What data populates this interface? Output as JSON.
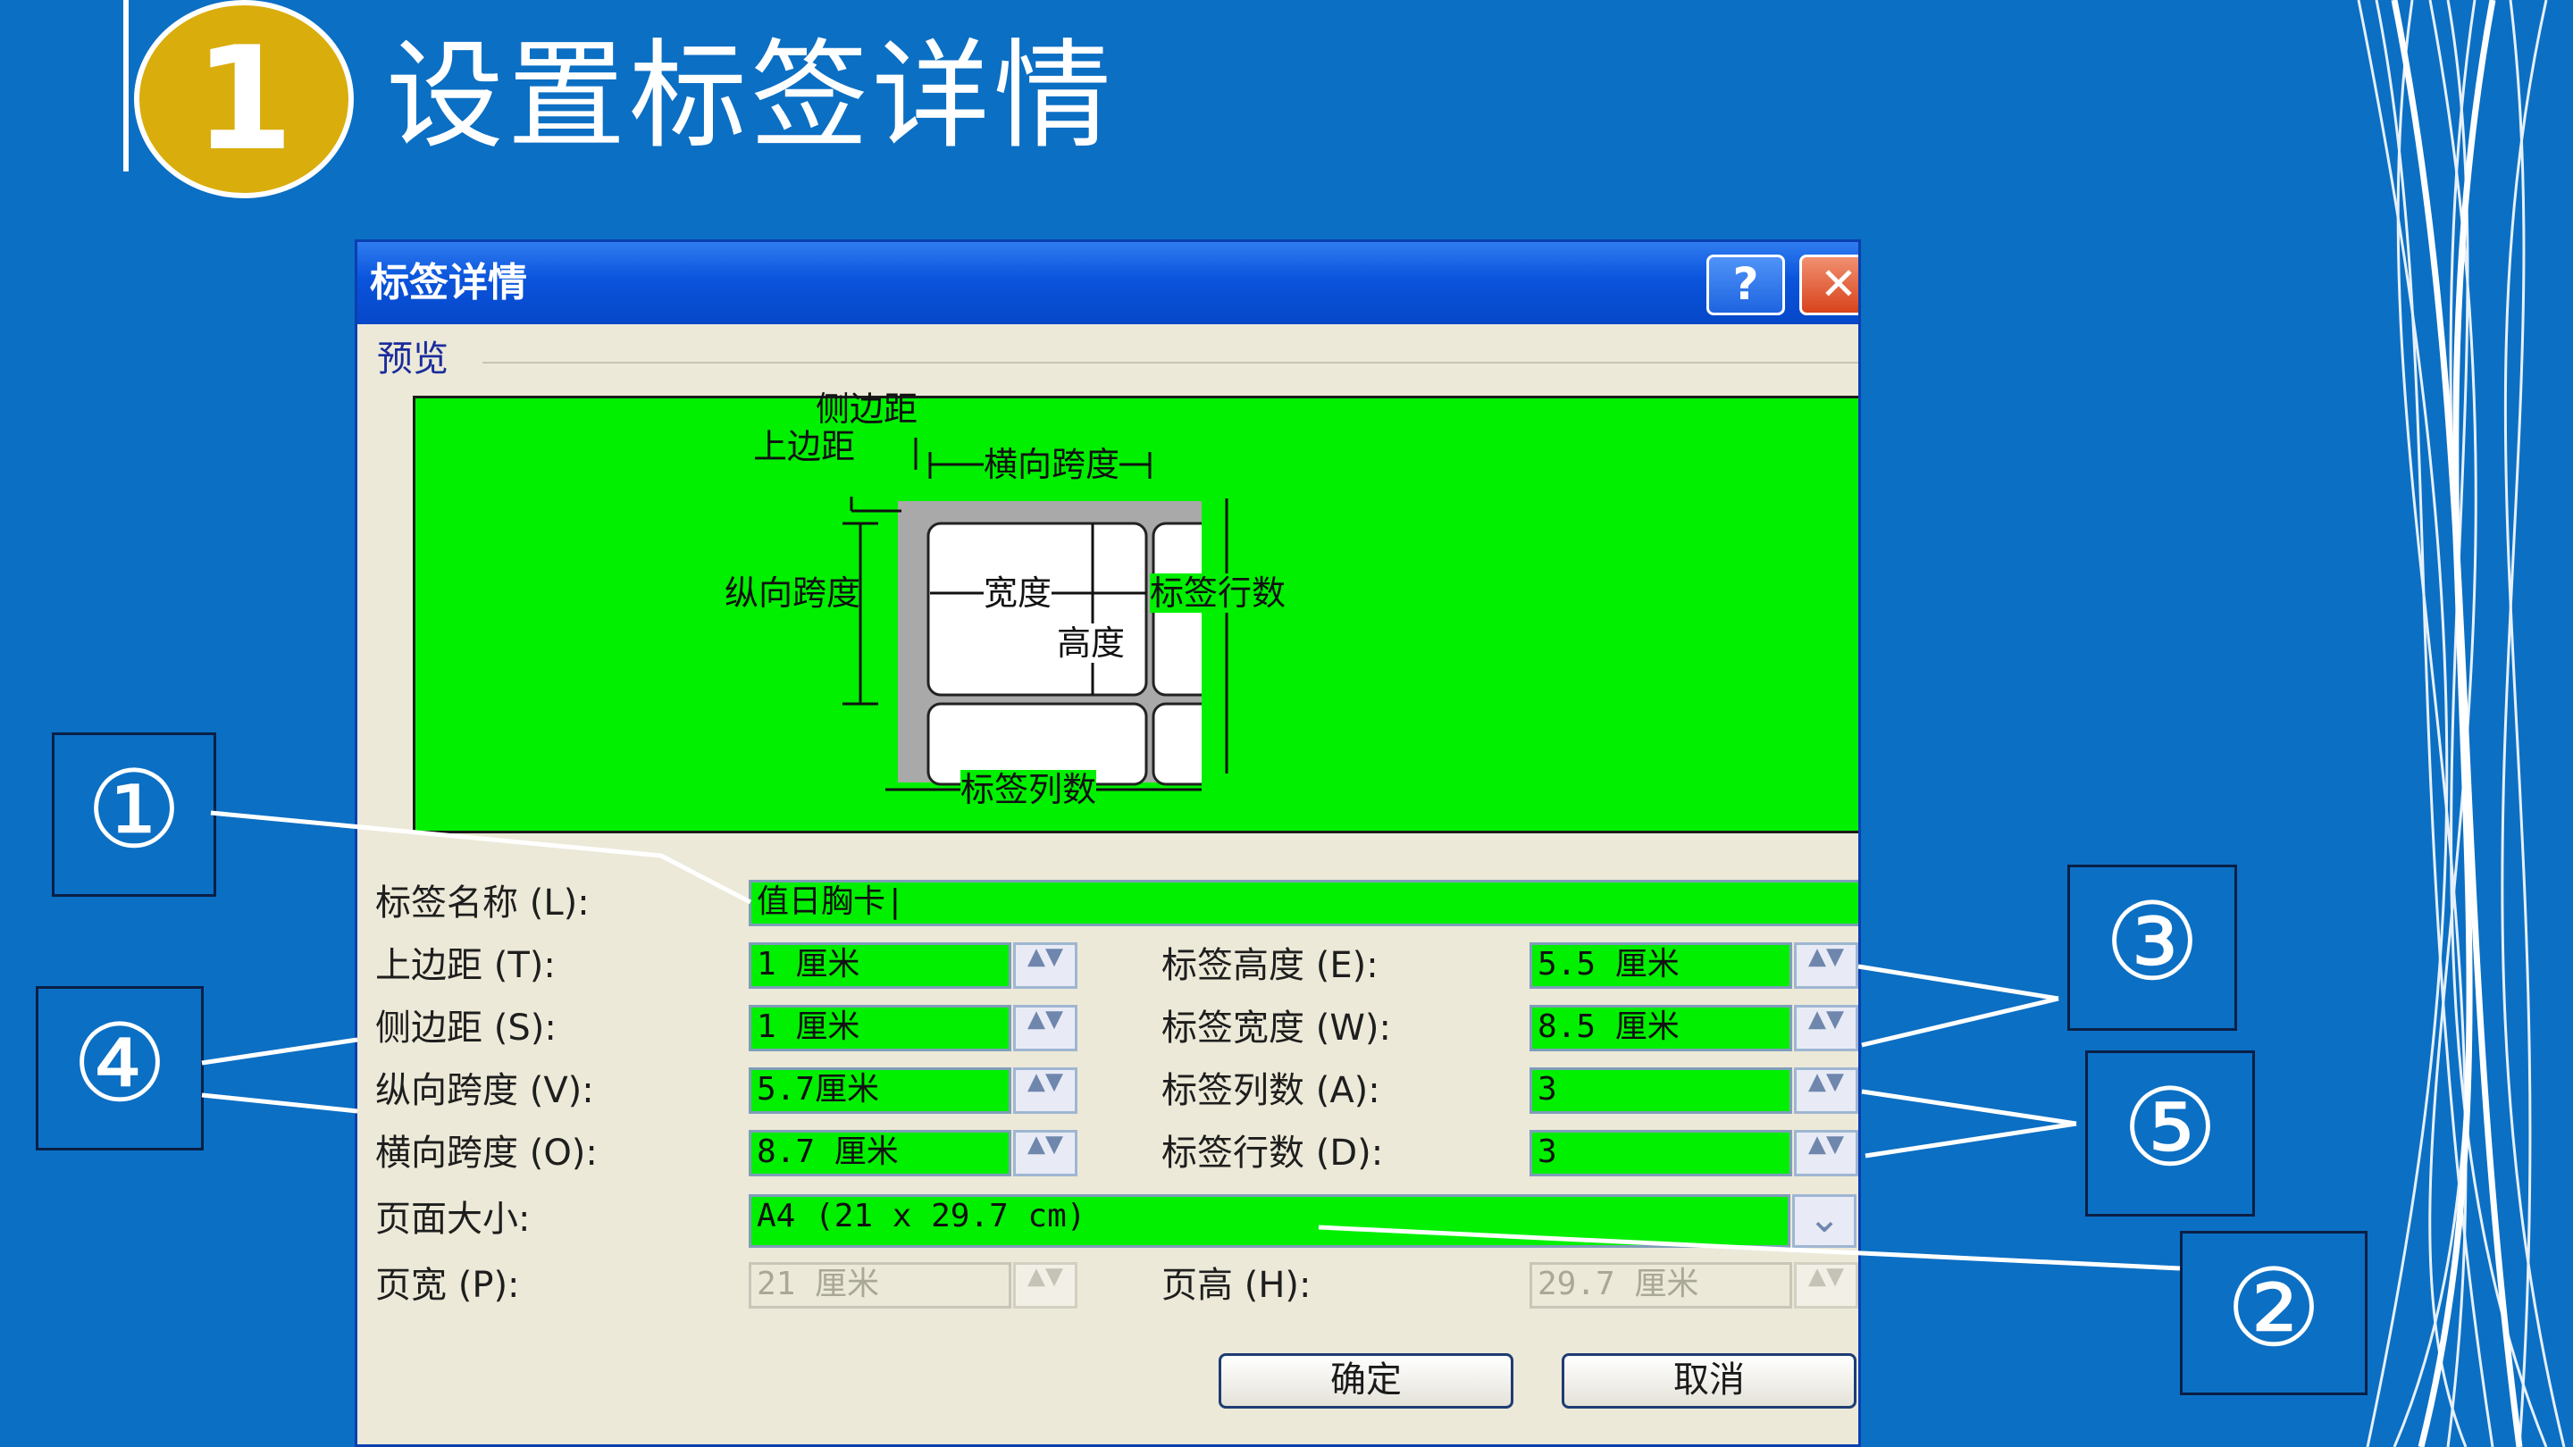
{
  "slide": {
    "number": "1",
    "title": "设置标签详情"
  },
  "dialog": {
    "title": "标签详情",
    "help_icon": "?",
    "close_icon": "✕",
    "group_label": "预览",
    "preview": {
      "side_margin": "侧边距",
      "top_margin": "上边距",
      "horizontal_pitch": "横向跨度",
      "vertical_pitch": "纵向跨度",
      "width": "宽度",
      "height": "高度",
      "rows": "标签行数",
      "columns": "标签列数"
    },
    "fields": {
      "label_name": {
        "label": "标签名称 (L):",
        "value": "值日胸卡|"
      },
      "top_margin": {
        "label": "上边距 (T):",
        "value": "1 厘米"
      },
      "side_margin": {
        "label": "侧边距 (S):",
        "value": "1 厘米"
      },
      "vertical_pitch": {
        "label": "纵向跨度 (V):",
        "value": "5.7厘米"
      },
      "horizontal_pitch": {
        "label": "横向跨度 (O):",
        "value": "8.7 厘米"
      },
      "label_height": {
        "label": "标签高度 (E):",
        "value": "5.5 厘米"
      },
      "label_width": {
        "label": "标签宽度 (W):",
        "value": "8.5 厘米"
      },
      "label_columns": {
        "label": "标签列数 (A):",
        "value": "3"
      },
      "label_rows": {
        "label": "标签行数 (D):",
        "value": "3"
      },
      "page_size": {
        "label": "页面大小:",
        "value": "A4 (21 x 29.7 cm)"
      },
      "page_width": {
        "label": "页宽 (P):",
        "value": "21 厘米"
      },
      "page_height": {
        "label": "页高 (H):",
        "value": "29.7 厘米"
      }
    },
    "spin_glyph": "▲▼",
    "dropdown_glyph": "⌄",
    "ok_label": "确定",
    "cancel_label": "取消"
  },
  "callouts": {
    "c1": "①",
    "c2": "②",
    "c3": "③",
    "c4": "④",
    "c5": "⑤"
  },
  "colors": {
    "background": "#0b6fc4",
    "badge": "#d9ad0c",
    "preview_green": "#00f000",
    "titlebar": "#0a54dc"
  }
}
